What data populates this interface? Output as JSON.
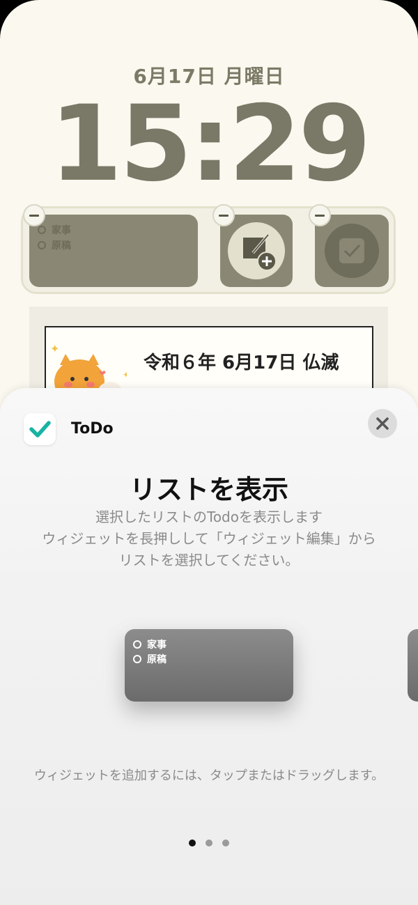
{
  "lockscreen": {
    "date": "6月17日 月曜日",
    "time": "15:29",
    "widgets": {
      "todo_items": [
        "家事",
        "原稿"
      ],
      "note_icon": "note-add-icon",
      "check_icon": "checkbox-icon"
    },
    "calendar": {
      "text": "令和６年 6月17日 仏滅"
    }
  },
  "sheet": {
    "app_name": "ToDo",
    "title": "リストを表示",
    "description_lines": [
      "選択したリストのTodoを表示します",
      "ウィジェットを長押しして「ウィジェット編集」から",
      "リストを選択してください。"
    ],
    "preview_items": [
      "家事",
      "原稿"
    ],
    "hint": "ウィジェットを追加するには、タップまたはドラッグします。",
    "page_count": 3,
    "active_page": 1
  },
  "colors": {
    "accent": "#17b3a3",
    "lockscreen_text": "#7a7866",
    "widget_bg": "#8a8874"
  }
}
